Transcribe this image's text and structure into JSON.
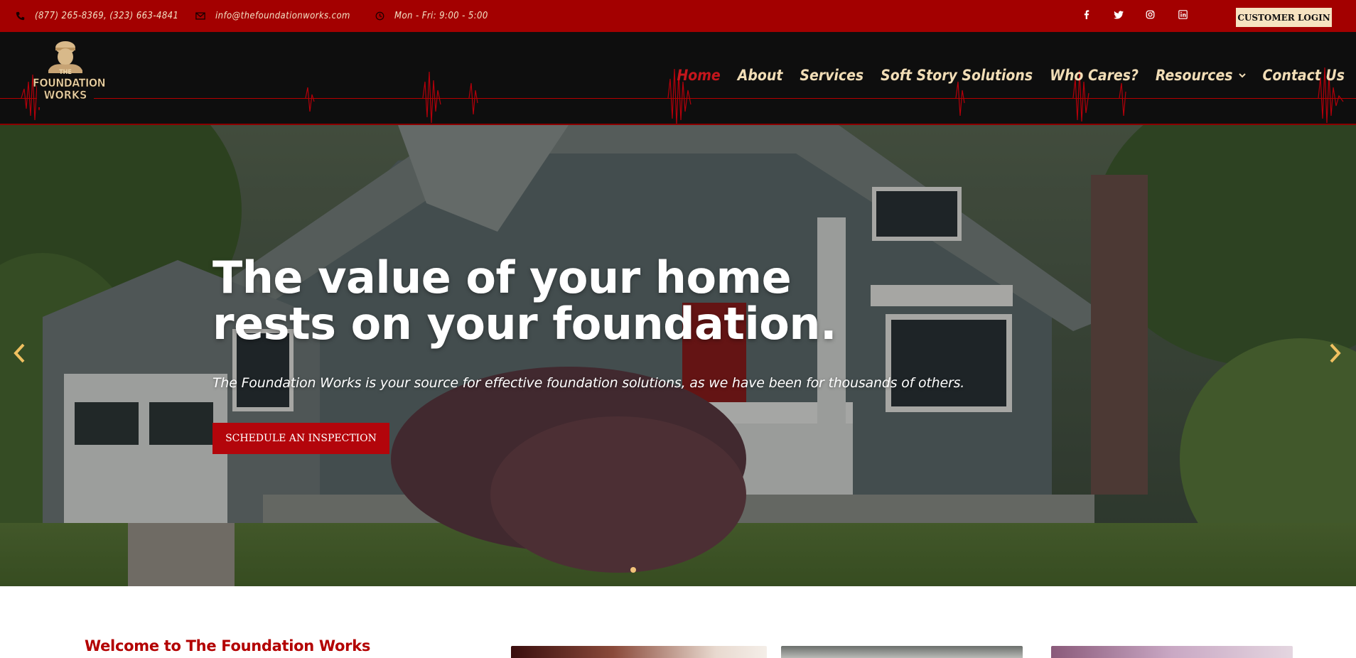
{
  "topbar": {
    "phone": "(877) 265-8369, (323) 663-4841",
    "email": "info@thefoundationworks.com",
    "hours": "Mon - Fri: 9:00 - 5:00",
    "social": [
      "facebook-icon",
      "twitter-icon",
      "instagram-icon",
      "linkedin-icon"
    ],
    "login_label": "CUSTOMER LOGIN"
  },
  "header": {
    "logo_text": [
      "THE",
      "FOUNDATION",
      "WORKS"
    ],
    "nav": [
      {
        "label": "Home",
        "active": true
      },
      {
        "label": "About"
      },
      {
        "label": "Services"
      },
      {
        "label": "Soft Story Solutions"
      },
      {
        "label": "Who Cares?"
      },
      {
        "label": "Resources",
        "dropdown": true
      },
      {
        "label": "Contact Us"
      }
    ]
  },
  "hero": {
    "headline": "The value of your home rests on your foundation.",
    "subhead": "The Foundation Works is your source for effective foundation solutions, as we have been for thousands of others.",
    "cta_label": "SCHEDULE AN INSPECTION",
    "prev_icon": "chevron-left-icon",
    "next_icon": "chevron-right-icon",
    "slide_count": 1
  },
  "intro": {
    "heading": "Welcome to The Foundation Works"
  },
  "colors": {
    "topbar": "#a30000",
    "header": "#0e0e0e",
    "accent": "#b3050b",
    "nav_text": "#f1ddb6",
    "nav_active": "#c4161c",
    "login_bg": "#f6e3c1"
  }
}
